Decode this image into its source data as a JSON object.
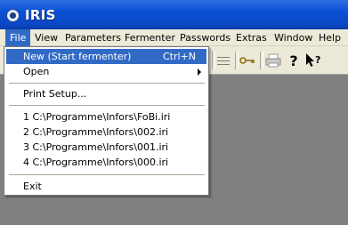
{
  "window": {
    "title": "IRIS",
    "icon": "iris-app-icon"
  },
  "menubar": {
    "items": [
      {
        "label": "File",
        "active": true
      },
      {
        "label": "View"
      },
      {
        "label": "Parameters"
      },
      {
        "label": "Fermenter"
      },
      {
        "label": "Passwords"
      },
      {
        "label": "Extras"
      },
      {
        "label": "Window"
      },
      {
        "label": "Help"
      }
    ]
  },
  "toolbar": {
    "icons": [
      "separator-icon",
      "key-icon",
      "printer-icon",
      "help-icon",
      "context-help-icon"
    ]
  },
  "file_menu": {
    "new_label": "New (Start fermenter)",
    "new_shortcut": "Ctrl+N",
    "open_label": "Open",
    "print_setup_label": "Print Setup...",
    "recent_files": [
      "1 C:\\Programme\\Infors\\FoBi.iri",
      "2 C:\\Programme\\Infors\\002.iri",
      "3 C:\\Programme\\Infors\\001.iri",
      "4 C:\\Programme\\Infors\\000.iri"
    ],
    "exit_label": "Exit"
  },
  "colors": {
    "titlebar": "#0a50d6",
    "highlight": "#316ac5",
    "workspace": "#808080",
    "menu_bg": "#ece9d8"
  }
}
